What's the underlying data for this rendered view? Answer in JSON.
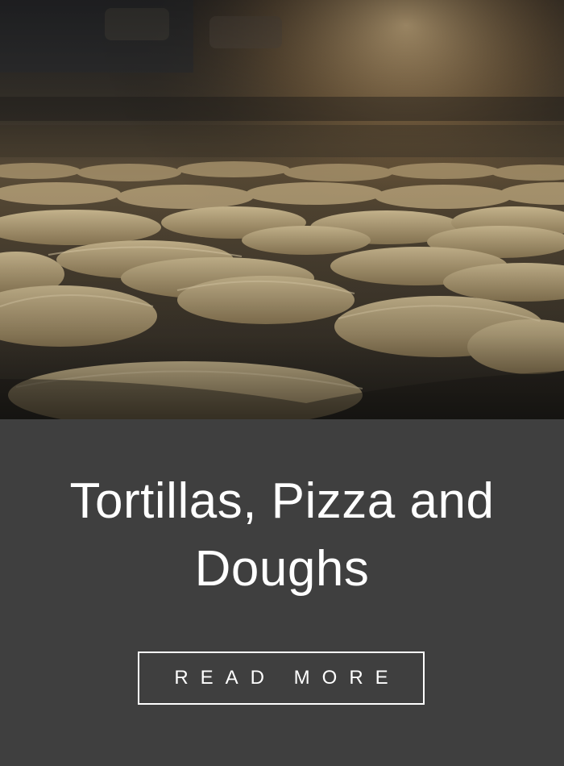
{
  "card": {
    "title": "Tortillas, Pizza and Doughs",
    "button_label": "READ MORE"
  },
  "image": {
    "subject": "tortillas on a production conveyor line"
  },
  "colors": {
    "panel_background": "#3f3f3f",
    "text": "#ffffff",
    "button_border": "#ffffff"
  }
}
